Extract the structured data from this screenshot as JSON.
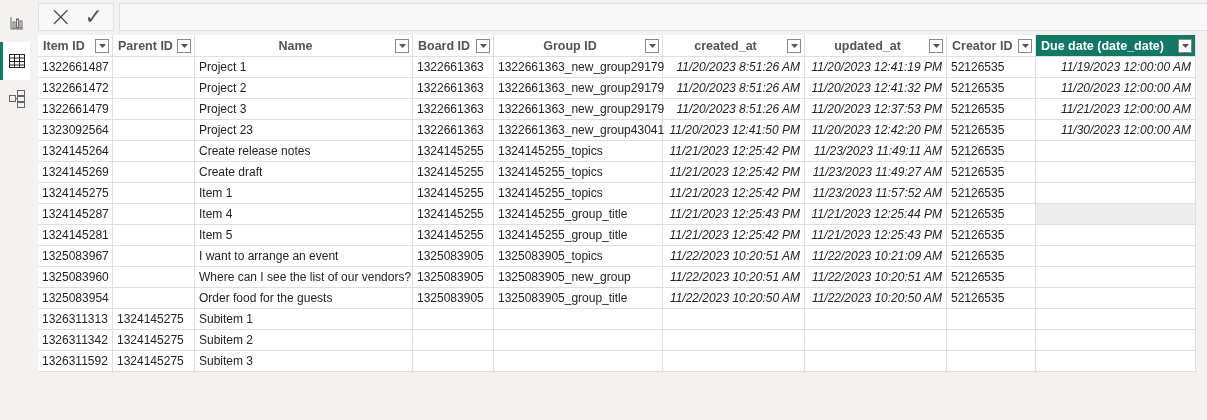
{
  "rail": [
    {
      "kind": "report",
      "selected": false
    },
    {
      "kind": "table",
      "selected": true
    },
    {
      "kind": "model",
      "selected": false
    }
  ],
  "formula_bar": {
    "cancel": "×",
    "commit": "✓"
  },
  "table": {
    "columns": [
      {
        "label": "Item ID",
        "kind": "text",
        "selected": false
      },
      {
        "label": "Parent ID",
        "kind": "text",
        "selected": false
      },
      {
        "label": "Name",
        "kind": "text",
        "selected": false
      },
      {
        "label": "Board ID",
        "kind": "text",
        "selected": false
      },
      {
        "label": "Group ID",
        "kind": "text",
        "selected": false
      },
      {
        "label": "created_at",
        "kind": "datetime",
        "selected": false
      },
      {
        "label": "updated_at",
        "kind": "datetime",
        "selected": false
      },
      {
        "label": "Creator ID",
        "kind": "text",
        "selected": false
      },
      {
        "label": "Due date (date_date)",
        "kind": "datetime",
        "selected": true
      }
    ],
    "rows": [
      {
        "hovered": false,
        "cells": [
          "1322661487",
          null,
          "Project 1",
          "1322661363",
          "1322661363_new_group29179",
          "11/20/2023 8:51:26 AM",
          "11/20/2023 12:41:19 PM",
          "52126535",
          "11/19/2023 12:00:00 AM"
        ]
      },
      {
        "hovered": false,
        "cells": [
          "1322661472",
          null,
          "Project 2",
          "1322661363",
          "1322661363_new_group29179",
          "11/20/2023 8:51:26 AM",
          "11/20/2023 12:41:32 PM",
          "52126535",
          "11/20/2023 12:00:00 AM"
        ]
      },
      {
        "hovered": false,
        "cells": [
          "1322661479",
          null,
          "Project 3",
          "1322661363",
          "1322661363_new_group29179",
          "11/20/2023 8:51:26 AM",
          "11/20/2023 12:37:53 PM",
          "52126535",
          "11/21/2023 12:00:00 AM"
        ]
      },
      {
        "hovered": false,
        "cells": [
          "1323092564",
          null,
          "Project 23",
          "1322661363",
          "1322661363_new_group43041",
          "11/20/2023 12:41:50 PM",
          "11/20/2023 12:42:20 PM",
          "52126535",
          "11/30/2023 12:00:00 AM"
        ]
      },
      {
        "hovered": false,
        "cells": [
          "1324145264",
          null,
          "Create release notes",
          "1324145255",
          "1324145255_topics",
          "11/21/2023 12:25:42 PM",
          "11/23/2023 11:49:11 AM",
          "52126535",
          null
        ]
      },
      {
        "hovered": false,
        "cells": [
          "1324145269",
          null,
          "Create draft",
          "1324145255",
          "1324145255_topics",
          "11/21/2023 12:25:42 PM",
          "11/23/2023 11:49:27 AM",
          "52126535",
          null
        ]
      },
      {
        "hovered": false,
        "cells": [
          "1324145275",
          null,
          "Item 1",
          "1324145255",
          "1324145255_topics",
          "11/21/2023 12:25:42 PM",
          "11/23/2023 11:57:52 AM",
          "52126535",
          null
        ]
      },
      {
        "hovered": true,
        "cells": [
          "1324145287",
          null,
          "Item 4",
          "1324145255",
          "1324145255_group_title",
          "11/21/2023 12:25:43 PM",
          "11/21/2023 12:25:44 PM",
          "52126535",
          null
        ]
      },
      {
        "hovered": false,
        "cells": [
          "1324145281",
          null,
          "Item 5",
          "1324145255",
          "1324145255_group_title",
          "11/21/2023 12:25:42 PM",
          "11/21/2023 12:25:43 PM",
          "52126535",
          null
        ]
      },
      {
        "hovered": false,
        "cells": [
          "1325083967",
          null,
          "I want to arrange an event",
          "1325083905",
          "1325083905_topics",
          "11/22/2023 10:20:51 AM",
          "11/22/2023 10:21:09 AM",
          "52126535",
          null
        ]
      },
      {
        "hovered": false,
        "cells": [
          "1325083960",
          null,
          "Where can I see the list of our vendors?",
          "1325083905",
          "1325083905_new_group",
          "11/22/2023 10:20:51 AM",
          "11/22/2023 10:20:51 AM",
          "52126535",
          null
        ]
      },
      {
        "hovered": false,
        "cells": [
          "1325083954",
          null,
          "Order food for the guests",
          "1325083905",
          "1325083905_group_title",
          "11/22/2023 10:20:50 AM",
          "11/22/2023 10:20:50 AM",
          "52126535",
          null
        ]
      },
      {
        "hovered": false,
        "cells": [
          "1326311313",
          "1324145275",
          "Subitem 1",
          null,
          null,
          null,
          null,
          null,
          null
        ]
      },
      {
        "hovered": false,
        "cells": [
          "1326311342",
          "1324145275",
          "Subitem 2",
          null,
          null,
          null,
          null,
          null,
          null
        ]
      },
      {
        "hovered": false,
        "cells": [
          "1326311592",
          "1324145275",
          "Subitem 3",
          null,
          null,
          null,
          null,
          null,
          null
        ]
      }
    ]
  }
}
